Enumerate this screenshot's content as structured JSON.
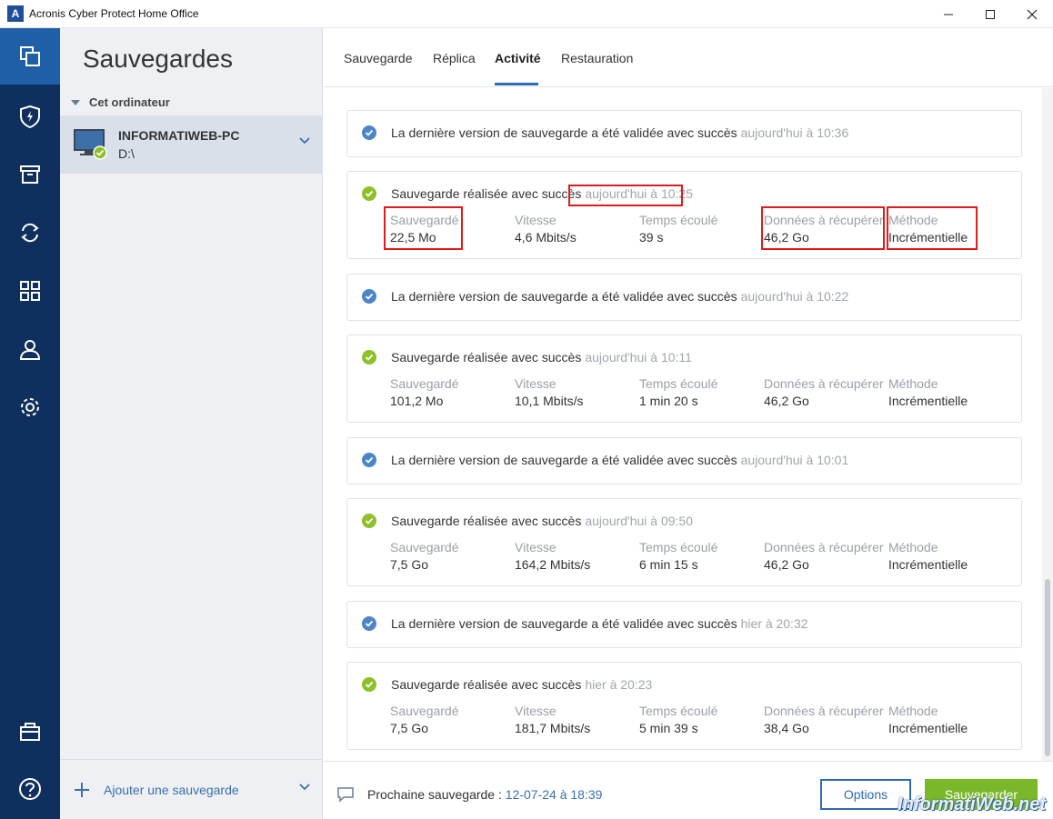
{
  "window": {
    "title": "Acronis Cyber Protect Home Office",
    "logo_letter": "A"
  },
  "rail": {
    "items": [
      "backup-icon",
      "protection-shield-icon",
      "archive-icon",
      "sync-icon",
      "tools-grid-icon",
      "account-icon",
      "settings-gear-icon",
      "store-bag-icon",
      "help-icon"
    ],
    "active_index": 0
  },
  "sidebar": {
    "title": "Sauvegardes",
    "section": "Cet ordinateur",
    "source": {
      "name": "INFORMATIWEB-PC",
      "path": "D:\\"
    },
    "add_label": "Ajouter une sauvegarde"
  },
  "tabs": [
    {
      "label": "Sauvegarde",
      "active": false
    },
    {
      "label": "Réplica",
      "active": false
    },
    {
      "label": "Activité",
      "active": true
    },
    {
      "label": "Restauration",
      "active": false
    }
  ],
  "labels": {
    "backed_up": "Sauvegardé",
    "speed": "Vitesse",
    "elapsed": "Temps écoulé",
    "data_to_recover": "Données à récupérer",
    "method": "Méthode"
  },
  "activity": [
    {
      "kind": "validation",
      "text": "La dernière version de sauvegarde a été validée avec succès",
      "time": "aujourd'hui à 10:36"
    },
    {
      "kind": "backup",
      "text": "Sauvegarde réalisée avec succès",
      "time": "aujourd'hui à 10:25",
      "backed_up": "22,5 Mo",
      "speed": "4,6 Mbits/s",
      "elapsed": "39 s",
      "data_to_recover": "46,2 Go",
      "method": "Incrémentielle"
    },
    {
      "kind": "validation",
      "text": "La dernière version de sauvegarde a été validée avec succès",
      "time": "aujourd'hui à 10:22"
    },
    {
      "kind": "backup",
      "text": "Sauvegarde réalisée avec succès",
      "time": "aujourd'hui à 10:11",
      "backed_up": "101,2 Mo",
      "speed": "10,1 Mbits/s",
      "elapsed": "1 min 20 s",
      "data_to_recover": "46,2 Go",
      "method": "Incrémentielle"
    },
    {
      "kind": "validation",
      "text": "La dernière version de sauvegarde a été validée avec succès",
      "time": "aujourd'hui à 10:01"
    },
    {
      "kind": "backup",
      "text": "Sauvegarde réalisée avec succès",
      "time": "aujourd'hui à 09:50",
      "backed_up": "7,5 Go",
      "speed": "164,2 Mbits/s",
      "elapsed": "6 min 15 s",
      "data_to_recover": "46,2 Go",
      "method": "Incrémentielle"
    },
    {
      "kind": "validation",
      "text": "La dernière version de sauvegarde a été validée avec succès",
      "time": "hier à 20:32"
    },
    {
      "kind": "backup",
      "text": "Sauvegarde réalisée avec succès",
      "time": "hier à 20:23",
      "backed_up": "7,5 Go",
      "speed": "181,7 Mbits/s",
      "elapsed": "5 min 39 s",
      "data_to_recover": "38,4 Go",
      "method": "Incrémentielle"
    }
  ],
  "footer": {
    "next_label": "Prochaine sauvegarde :",
    "next_value": "12-07-24 à 18:39",
    "options_label": "Options",
    "save_label": "Sauvegarder"
  },
  "watermark": "InformatiWeb.net",
  "colors": {
    "rail_bg": "#0f2f5e",
    "rail_active": "#1f5fa8",
    "accent_blue": "#2e6bb5",
    "success_green": "#8fbf2a",
    "validated_blue": "#4d86c8",
    "save_button": "#7ab82a",
    "highlight_red": "#e01b1b"
  }
}
